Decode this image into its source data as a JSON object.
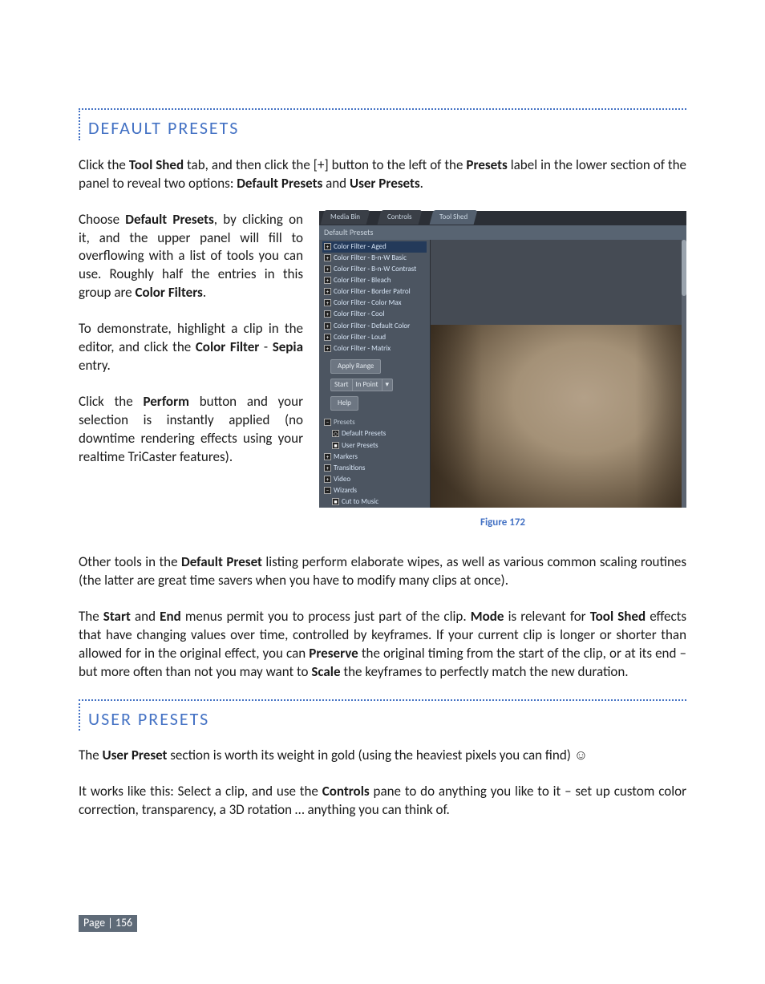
{
  "section1": {
    "title": "DEFAULT PRESETS",
    "intro": "Click the {Tool Shed} tab, and then click the [+] button to the left of the {Presets} label in the lower section of the panel to reveal two options: {Default Presets} and {User Presets}.",
    "p1": "Choose {Default Presets}, by clicking on it, and the upper panel will fill to overflowing with a list of tools you can use. Roughly half the entries in this group are {Color Filters}.",
    "p2": "To demonstrate, highlight a clip in the editor, and click the {Color Filter} - {Sepia} entry.",
    "p3": "Click the {Perform} button and your selection is instantly applied (no downtime rendering effects using your realtime TriCaster features).",
    "after1": "Other tools in the {Default Preset} listing perform elaborate wipes, as well as various common scaling routines (the latter are great time savers when you have to modify many clips at once).",
    "after2": "The {Start} and {End} menus permit you to process just part of the clip. {Mode} is relevant for {Tool Shed} effects that have changing values over time, controlled by keyframes.  If your current clip is longer or shorter than allowed for in the original effect, you can {Preserve} the original timing from the start of the clip, or at its end – but more often than not you may want to {Scale} the keyframes to perfectly match the new duration."
  },
  "section2": {
    "title": "USER PRESETS",
    "p1": "The {User Preset} section is worth its weight in gold (using the heaviest pixels you can find) ☺",
    "p2": "It works like this: Select a clip, and use the {Controls} pane to do anything you like to it – set up custom color correction, transparency, a 3D rotation … anything you can think of."
  },
  "figure": {
    "caption": "Figure 172",
    "tabs": [
      "Media Bin",
      "Controls",
      "Tool Shed"
    ],
    "active_tab": 2,
    "bar": "Default Presets",
    "filters": [
      "Color Filter - Aged",
      "Color Filter - B-n-W Basic",
      "Color Filter - B-n-W Contrast",
      "Color Filter - Bleach",
      "Color Filter - Border Patrol",
      "Color Filter - Color Max",
      "Color Filter - Cool",
      "Color Filter - Default Color",
      "Color Filter - Loud",
      "Color Filter - Matrix"
    ],
    "apply_label": "Apply Range",
    "start_label": "Start",
    "start_value": "In Point",
    "help_label": "Help",
    "tree": [
      "Presets",
      "Default Presets",
      "User Presets",
      "Markers",
      "Transitions",
      "Video",
      "Wizards",
      "Cut to Music"
    ]
  },
  "page": "Page | 156"
}
